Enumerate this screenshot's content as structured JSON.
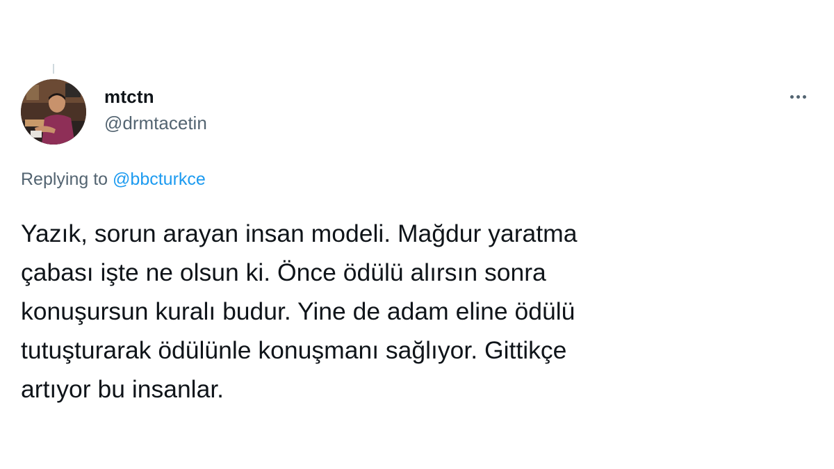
{
  "author": {
    "display_name": "mtctn",
    "handle": "@drmtacetin",
    "avatar_icon": "profile-photo"
  },
  "menu": {
    "icon": "more-horizontal-icon"
  },
  "reply": {
    "prefix": "Replying to",
    "mention": "@bbcturkce"
  },
  "tweet": {
    "lines": [
      "Yazık, sorun arayan insan modeli. Mağdur yaratma",
      "çabası işte ne olsun ki. Önce ödülü alırsın sonra",
      "konuşursun kuralı budur. Yine de adam eline ödülü",
      "tutuşturarak ödülünle konuşmanı sağlıyor. Gittikçe",
      "artıyor bu insanlar."
    ]
  },
  "colors": {
    "text": "#0f1419",
    "secondary": "#536471",
    "link": "#1d9bf0"
  }
}
